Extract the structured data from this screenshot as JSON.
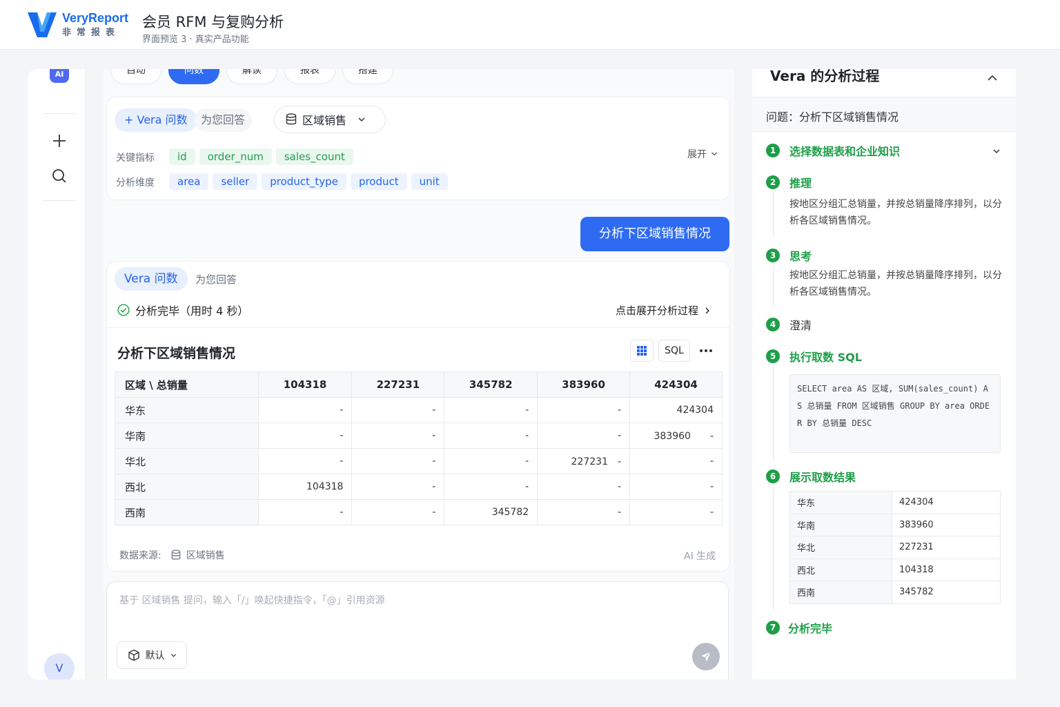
{
  "header": {
    "brand": "VeryReport",
    "brand_sub": "非常报表",
    "title": "会员 RFM 与复购分析",
    "subtitle": "界面预览 3 · 真实产品功能"
  },
  "rail": {
    "ai_badge": "AI",
    "avatar": "V"
  },
  "tabs": [
    "自动",
    "问数",
    "解读",
    "报表",
    "搭建"
  ],
  "dataset_card": {
    "vera_label": "+ Vera 问数",
    "answer_label": "为您回答",
    "dataset_name": "区域销售",
    "metrics_label": "关键指标",
    "metrics": [
      "id",
      "order_num",
      "sales_count"
    ],
    "dims_label": "分析维度",
    "dims": [
      "area",
      "seller",
      "product_type",
      "product",
      "unit"
    ],
    "expand_label": "展开"
  },
  "user_message": "分析下区域销售情况",
  "answer": {
    "vera_label": "Vera 问数",
    "answer_label": "为您回答",
    "status": "分析完毕（用时 4 秒）",
    "expand_link": "点击展开分析过程",
    "table_title": "分析下区域销售情况",
    "sql_button": "SQL",
    "corner_header": "区域 \\ 总销量",
    "columns": [
      "104318",
      "227231",
      "345782",
      "383960",
      "424304"
    ],
    "rows": [
      {
        "region": "华东",
        "cells": [
          "-",
          "-",
          "-",
          "-",
          "424304"
        ]
      },
      {
        "region": "华南",
        "cells": [
          "-",
          "-",
          "-",
          "-",
          "383960　　-"
        ]
      },
      {
        "region": "华北",
        "cells": [
          "-",
          "-",
          "-",
          "227231　-",
          "-"
        ]
      },
      {
        "region": "西北",
        "cells": [
          "104318",
          "-",
          "-",
          "-",
          "-"
        ]
      },
      {
        "region": "西南",
        "cells": [
          "-",
          "-",
          "345782",
          "-",
          "-"
        ]
      }
    ],
    "source_label": "数据来源:",
    "source_name": "区域销售",
    "ai_generated": "AI 生成"
  },
  "input": {
    "placeholder": "基于 区域销售 提问，输入「/」唤起快捷指令，「@」引用资源",
    "mode": "默认"
  },
  "process": {
    "title": "Vera 的分析过程",
    "question": "问题：分析下区域销售情况",
    "steps": [
      {
        "n": "1",
        "title": "选择数据表和企业知识"
      },
      {
        "n": "2",
        "title": "推理",
        "body": "按地区分组汇总销量，并按总销量降序排列，以分析各区域销售情况。"
      },
      {
        "n": "3",
        "title": "思考",
        "body": "按地区分组汇总销量，并按总销量降序排列，以分析各区域销售情况。"
      },
      {
        "n": "4",
        "title": "澄清"
      },
      {
        "n": "5",
        "title": "执行取数 SQL"
      },
      {
        "n": "6",
        "title": "展示取数结果"
      },
      {
        "n": "7",
        "title": "分析完毕"
      }
    ],
    "sql": "SELECT area AS 区域, SUM(sales_count) AS 总销量 FROM 区域销售 GROUP BY area ORDER BY 总销量 DESC",
    "result": [
      {
        "k": "华东",
        "v": "424304"
      },
      {
        "k": "华南",
        "v": "383960"
      },
      {
        "k": "华北",
        "v": "227231"
      },
      {
        "k": "西北",
        "v": "104318"
      },
      {
        "k": "西南",
        "v": "345782"
      }
    ]
  },
  "colors": {
    "primary": "#2f6bf2",
    "success": "#1e9e48",
    "brand": "#1a6bf0"
  }
}
